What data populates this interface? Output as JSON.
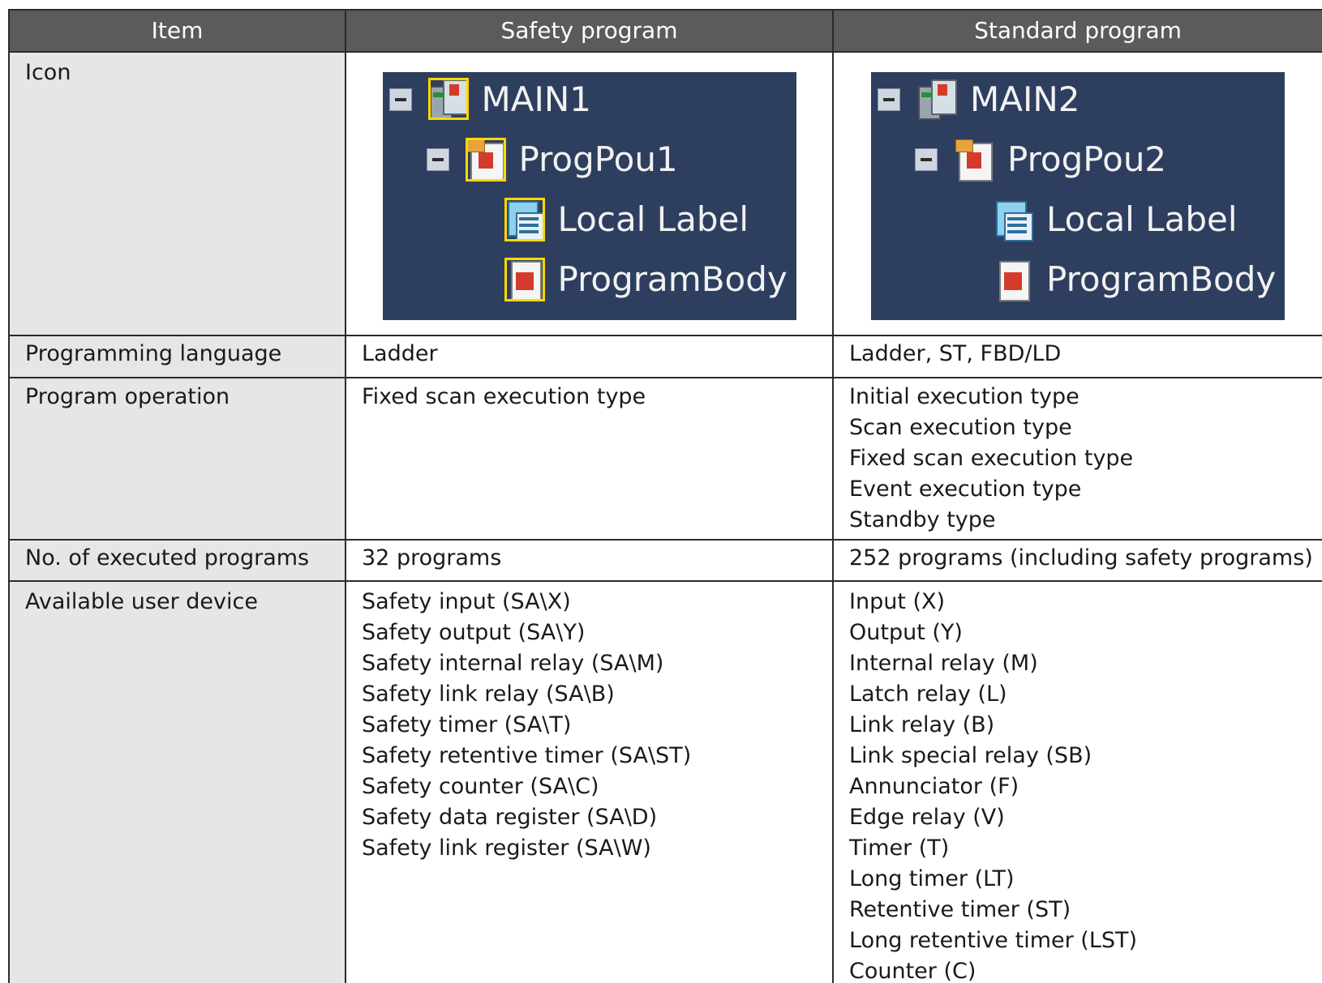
{
  "table": {
    "headers": [
      "Item",
      "Safety program",
      "Standard program"
    ],
    "icon_row": {
      "item": "Icon",
      "safety_tree": [
        "MAIN1",
        "ProgPou1",
        "Local Label",
        "ProgramBody"
      ],
      "standard_tree": [
        "MAIN2",
        "ProgPou2",
        "Local Label",
        "ProgramBody"
      ],
      "icons": [
        "program-file-icon",
        "pou-icon",
        "local-label-icon",
        "program-body-icon",
        "collapse-minus-icon"
      ],
      "safety_highlight_color": "#ffd800",
      "tree_background": "#2e3e5f"
    },
    "rows": [
      {
        "item": "Programming language",
        "safety": [
          "Ladder"
        ],
        "standard": [
          "Ladder, ST, FBD/LD"
        ]
      },
      {
        "item": "Program operation",
        "safety": [
          "Fixed scan execution type"
        ],
        "standard": [
          "Initial execution type",
          "Scan execution type",
          "Fixed scan execution type",
          "Event execution type",
          "Standby type"
        ]
      },
      {
        "item": "No. of executed programs",
        "safety": [
          "32 programs"
        ],
        "standard": [
          "252 programs (including safety programs)"
        ]
      },
      {
        "item": "Available user device",
        "safety": [
          "Safety input (SA\\X)",
          "Safety output (SA\\Y)",
          "Safety internal relay (SA\\M)",
          "Safety link relay (SA\\B)",
          "Safety timer (SA\\T)",
          "Safety retentive timer (SA\\ST)",
          "Safety counter (SA\\C)",
          "Safety data register (SA\\D)",
          "Safety link register (SA\\W)"
        ],
        "standard": [
          "Input (X)",
          "Output (Y)",
          "Internal relay (M)",
          "Latch relay (L)",
          "Link relay (B)",
          "Link special relay (SB)",
          "Annunciator (F)",
          "Edge relay (V)",
          "Timer (T)",
          "Long timer (LT)",
          "Retentive timer (ST)",
          "Long retentive timer (LST)",
          "Counter (C)"
        ]
      }
    ]
  }
}
